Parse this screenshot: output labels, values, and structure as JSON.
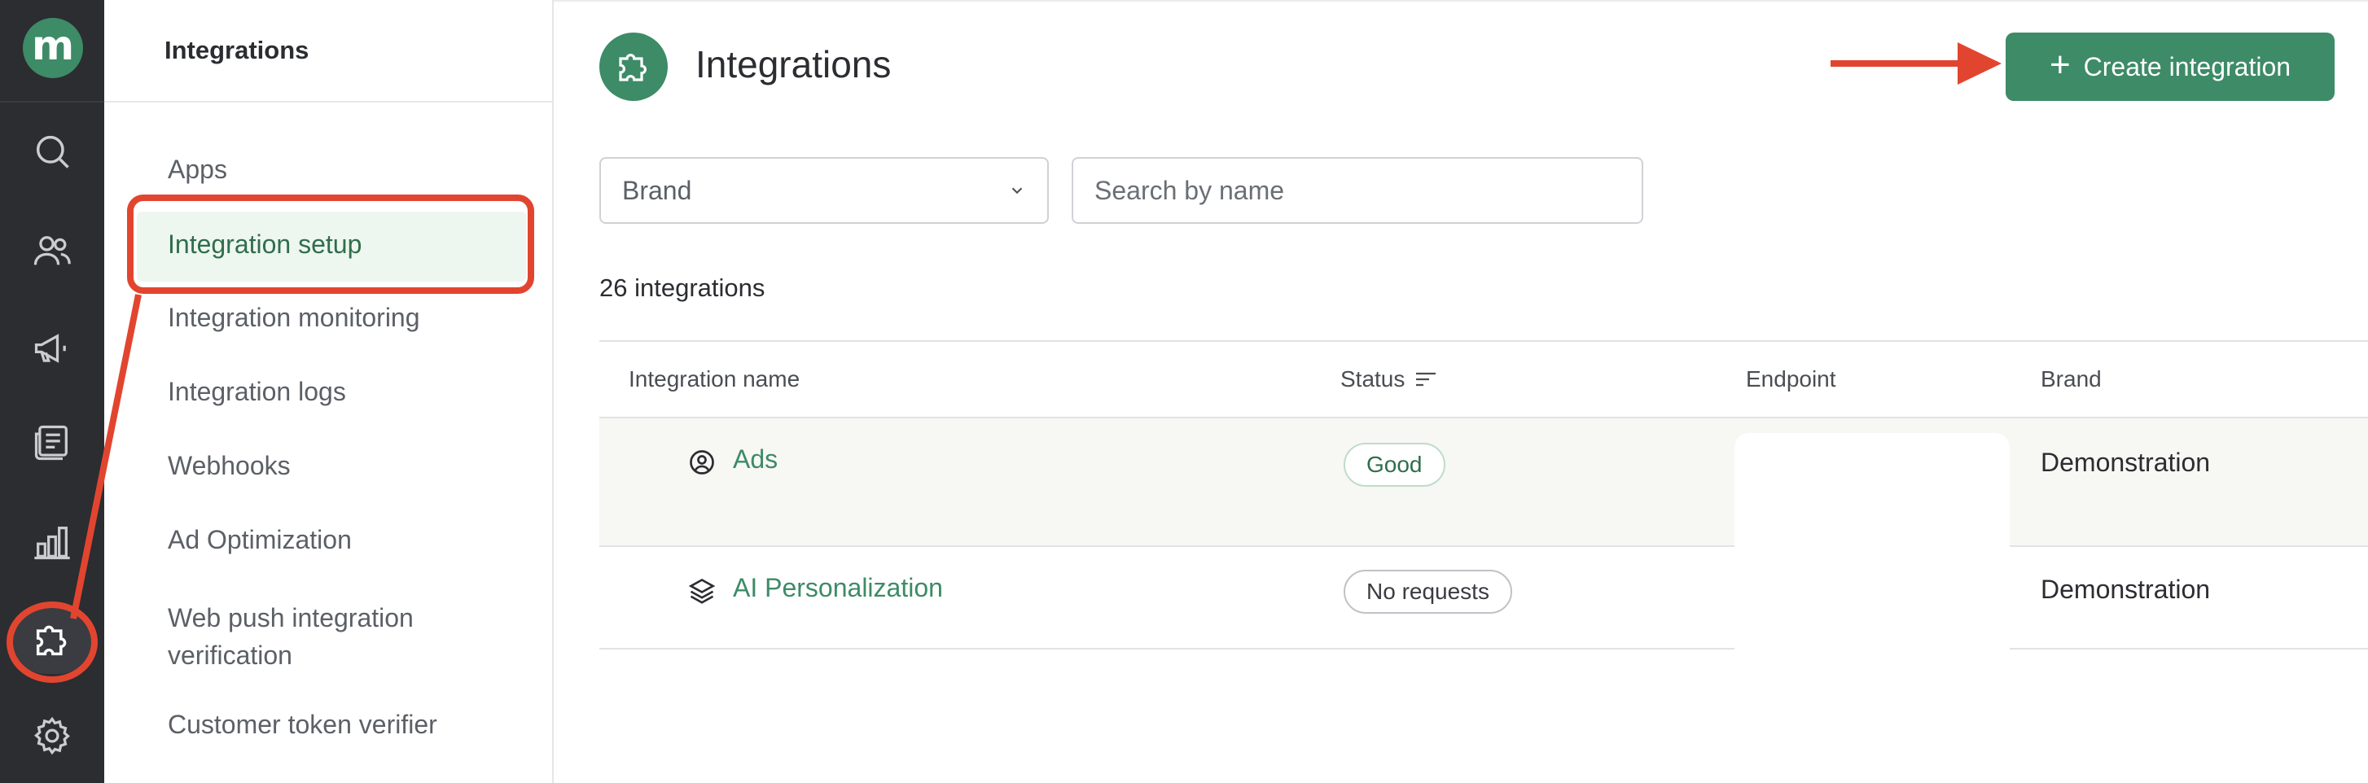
{
  "colors": {
    "rail_bg": "#2b2d31",
    "brand_green": "#3d8b67",
    "active_bg": "#eef6f0",
    "annotation_red": "#e2452f"
  },
  "rail": {
    "logo": "m",
    "icons": [
      "search-icon",
      "users-icon",
      "megaphone-icon",
      "news-icon",
      "chart-icon",
      "puzzle-icon",
      "gear-icon"
    ],
    "active": "puzzle-icon"
  },
  "submenu": {
    "title": "Integrations",
    "items": [
      {
        "label": "Apps"
      },
      {
        "label": "Integration setup"
      },
      {
        "label": "Integration monitoring"
      },
      {
        "label": "Integration logs"
      },
      {
        "label": "Webhooks"
      },
      {
        "label": "Ad Optimization"
      },
      {
        "label": "Web push integration verification"
      },
      {
        "label": "Customer token verifier"
      }
    ],
    "active": "Integration setup"
  },
  "main": {
    "title": "Integrations",
    "title_icon": "puzzle-icon",
    "create_button": {
      "label": "Create integration",
      "icon": "plus-icon"
    },
    "filters": {
      "brand": {
        "value": "Brand"
      },
      "search": {
        "placeholder": "Search by name",
        "value": ""
      }
    },
    "count_text": "26 integrations",
    "table": {
      "columns": [
        "Integration name",
        "Status",
        "Endpoint",
        "Brand"
      ],
      "status_sort_icon": "sort-icon",
      "rows": [
        {
          "icon": "user-circle-icon",
          "name": "Ads",
          "status": "Good",
          "endpoint": "",
          "brand": "Demonstration"
        },
        {
          "icon": "layers-icon",
          "name": "AI Personalization",
          "status": "No requests",
          "endpoint": "",
          "brand": "Demonstration"
        }
      ]
    }
  }
}
